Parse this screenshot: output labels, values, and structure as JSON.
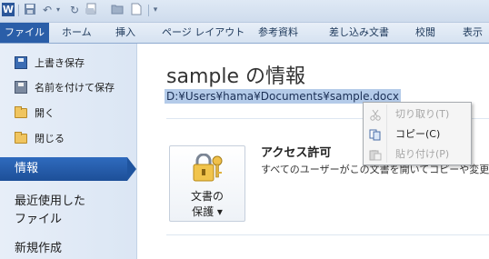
{
  "colors": {
    "accent": "#2a5ea8",
    "selected_nav": "#1d4f98",
    "path_highlight": "#b4cbe9"
  },
  "qat": {
    "app_icon_label": "W",
    "icons": [
      "word-app-icon",
      "save-icon",
      "undo-icon",
      "redo-icon",
      "open-icon",
      "new-icon",
      "customize-icon"
    ]
  },
  "ribbon_tabs": [
    "ファイル",
    "ホーム",
    "挿入",
    "ページ レイアウト",
    "参考資料",
    "差し込み文書",
    "校閲",
    "表示"
  ],
  "backstage": {
    "commands": [
      "上書き保存",
      "名前を付けて保存",
      "開く",
      "閉じる"
    ],
    "selected": "情報",
    "recent": [
      "最近使用した",
      "ファイル"
    ],
    "new": "新規作成"
  },
  "info": {
    "title": "sample の情報",
    "path": "D:¥Users¥hama¥Documents¥sample.docx",
    "protect_line1": "文書の",
    "protect_line2": "保護 ▾",
    "section_title": "アクセス許可",
    "section_desc": "すべてのユーザーがこの文書を開いてコピーや変更"
  },
  "context_menu": {
    "items": [
      {
        "label": "切り取り(T)",
        "enabled": false,
        "icon": "scissors-icon"
      },
      {
        "label": "コピー(C)",
        "enabled": true,
        "icon": "copy-icon"
      },
      {
        "label": "貼り付け(P)",
        "enabled": false,
        "icon": "paste-icon"
      }
    ]
  }
}
